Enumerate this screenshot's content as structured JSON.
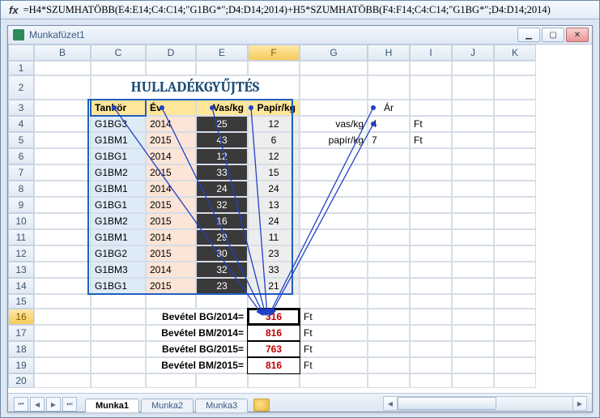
{
  "formula_bar": {
    "fx_label": "fx",
    "formula": "=H4*SZUMHATÖBB(E4:E14;C4:C14;\"G1BG*\";D4:D14;2014)+H5*SZUMHATÖBB(F4:F14;C4:C14;\"G1BG*\";D4:D14;2014)"
  },
  "window": {
    "title": "Munkafüzet1"
  },
  "columns": [
    "B",
    "C",
    "D",
    "E",
    "F",
    "G",
    "H",
    "I",
    "J",
    "K"
  ],
  "main_title": "HULLADÉKGYŰJTÉS",
  "table": {
    "headers": {
      "tankor": "Tankör",
      "ev": "Év",
      "vas": "Vas/kg",
      "papir": "Papír/kg"
    },
    "rows": [
      {
        "tankor": "G1BG3",
        "ev": "2014",
        "vas": "25",
        "papir": "12"
      },
      {
        "tankor": "G1BM1",
        "ev": "2015",
        "vas": "43",
        "papir": "6"
      },
      {
        "tankor": "G1BG1",
        "ev": "2014",
        "vas": "12",
        "papir": "12"
      },
      {
        "tankor": "G1BM2",
        "ev": "2015",
        "vas": "33",
        "papir": "15"
      },
      {
        "tankor": "G1BM1",
        "ev": "2014",
        "vas": "24",
        "papir": "24"
      },
      {
        "tankor": "G1BG1",
        "ev": "2015",
        "vas": "32",
        "papir": "13"
      },
      {
        "tankor": "G1BM2",
        "ev": "2015",
        "vas": "16",
        "papir": "24"
      },
      {
        "tankor": "G1BM1",
        "ev": "2014",
        "vas": "29",
        "papir": "11"
      },
      {
        "tankor": "G1BG2",
        "ev": "2015",
        "vas": "30",
        "papir": "23"
      },
      {
        "tankor": "G1BM3",
        "ev": "2014",
        "vas": "32",
        "papir": "33"
      },
      {
        "tankor": "G1BG1",
        "ev": "2015",
        "vas": "23",
        "papir": "21"
      }
    ]
  },
  "price": {
    "header": "Ár",
    "vas_label": "vas/kg",
    "vas_value": "4",
    "vas_unit": "Ft",
    "papir_label": "papír/kg",
    "papir_value": "7",
    "papir_unit": "Ft"
  },
  "revenue": [
    {
      "label": "Bevétel BG/2014=",
      "value": "316",
      "unit": "Ft"
    },
    {
      "label": "Bevétel BM/2014=",
      "value": "816",
      "unit": "Ft"
    },
    {
      "label": "Bevétel BG/2015=",
      "value": "763",
      "unit": "Ft"
    },
    {
      "label": "Bevétel BM/2015=",
      "value": "816",
      "unit": "Ft"
    }
  ],
  "sheets": {
    "s1": "Munka1",
    "s2": "Munka2",
    "s3": "Munka3"
  }
}
